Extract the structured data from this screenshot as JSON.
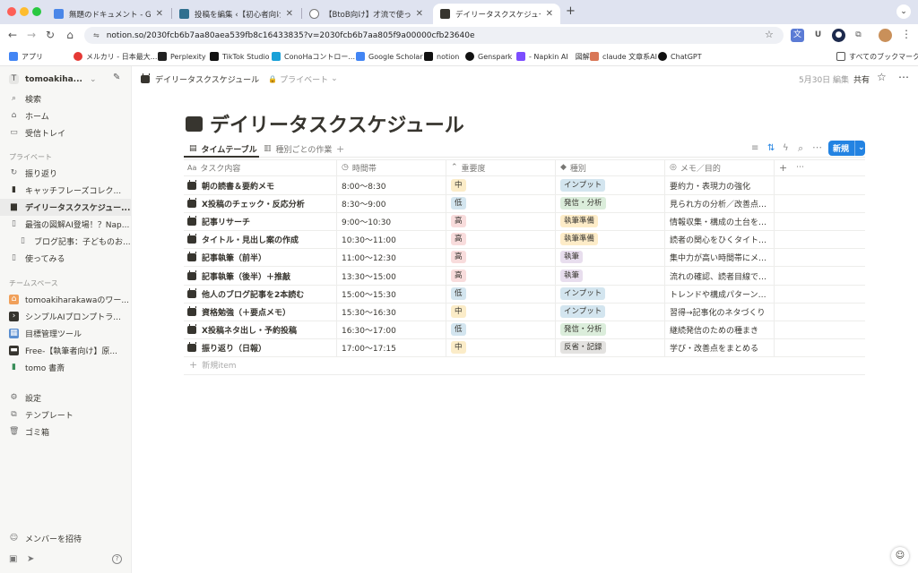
{
  "browser": {
    "tabs": [
      {
        "title": "無題のドキュメント - Google ドキュメント",
        "favicon_color": "#4a86e8"
      },
      {
        "title": "投稿を編集 ‹【初心者向けガイド】",
        "favicon_color": "#2f6f8f"
      },
      {
        "title": "【BtoB向け】才流で使っている",
        "favicon_color": "#777777"
      },
      {
        "title": "デイリータスクスケジュール | ク",
        "favicon_color": "#37352f"
      }
    ],
    "url": "notion.so/2030fcb6b7aa80aea539fb8c16433835?v=2030fcb6b7aa805f9a00000cfb23640e",
    "bookmarks": [
      {
        "label": "アプリ",
        "icon_color": "#4285f4"
      },
      {
        "label": "メルカリ - 日本最大...",
        "icon_color": "#e53935"
      },
      {
        "label": "Perplexity",
        "icon_color": "#222222"
      },
      {
        "label": "TikTok Studio",
        "icon_color": "#111111"
      },
      {
        "label": "ConoHaコントロー...",
        "icon_color": "#19a1d8"
      },
      {
        "label": "Google Scholar",
        "icon_color": "#4285f4"
      },
      {
        "label": "notion",
        "icon_color": "#111111"
      },
      {
        "label": "Genspark",
        "icon_color": "#111111"
      },
      {
        "label": "- Napkin AI　図解",
        "icon_color": "#7c4dff"
      },
      {
        "label": "claude 文章系AI",
        "icon_color": "#d97757"
      },
      {
        "label": "ChatGPT",
        "icon_color": "#111111"
      }
    ],
    "all_bookmarks": "すべてのブックマーク"
  },
  "sidebar": {
    "workspace": "tomoakiha...",
    "workspace_initial": "T",
    "top_items": [
      {
        "label": "検索",
        "icon": "search-icon"
      },
      {
        "label": "ホーム",
        "icon": "home-icon"
      },
      {
        "label": "受信トレイ",
        "icon": "inbox-icon"
      }
    ],
    "private_heading": "プライベート",
    "private_items": [
      {
        "label": "振り返り",
        "icon": "refresh-icon"
      },
      {
        "label": "キャッチフレーズコレク...",
        "icon": "book-icon"
      },
      {
        "label": "デイリータスクスケジュー...",
        "icon": "calendar-icon"
      },
      {
        "label": "最強の図解AI登場！？Nap...",
        "icon": "page-icon"
      },
      {
        "label": "ブログ記事：子どものお...",
        "icon": "page-icon"
      },
      {
        "label": "使ってみる",
        "icon": "page-icon"
      }
    ],
    "team_heading": "チームスペース",
    "team_items": [
      {
        "label": "tomoakiharakawaのワー...",
        "icon": "home-icon"
      },
      {
        "label": "シンプルAIプロンプトラ...",
        "icon": "terminal-icon"
      },
      {
        "label": "目標管理ツール",
        "icon": "grid-icon"
      },
      {
        "label": "Free-【執筆者向け】原...",
        "icon": "clapper-icon"
      },
      {
        "label": "tomo 書斎",
        "icon": "book-icon"
      }
    ],
    "bottom_items": [
      {
        "label": "設定",
        "icon": "gear-icon"
      },
      {
        "label": "テンプレート",
        "icon": "template-icon"
      },
      {
        "label": "ゴミ箱",
        "icon": "trash-icon"
      }
    ],
    "invite": "メンバーを招待"
  },
  "topbar": {
    "breadcrumb": "デイリータスクスケジュール",
    "privacy": "プライベート",
    "edited": "5月30日 編集",
    "share": "共有"
  },
  "page": {
    "title": "デイリータスクスケジュール",
    "views": [
      "タイムテーブル",
      "種別ごとの作業"
    ],
    "new_button": "新規",
    "columns": [
      "タスク内容",
      "時間帯",
      "重要度",
      "種別",
      "メモ／目的"
    ],
    "add_row": "新規item",
    "rows": [
      {
        "task": "朝の読書＆要約メモ",
        "time": "8:00〜8:30",
        "priority": "中",
        "type": "インプット",
        "memo": "要約力・表現力の強化"
      },
      {
        "task": "X投稿のチェック・反応分析",
        "time": "8:30〜9:00",
        "priority": "低",
        "type": "発信・分析",
        "memo": "見られ方の分析／改善点のヒント"
      },
      {
        "task": "記事リサーチ",
        "time": "9:00〜10:30",
        "priority": "高",
        "type": "執筆準備",
        "memo": "情報収集・構成の土台をつくる"
      },
      {
        "task": "タイトル・見出し案の作成",
        "time": "10:30〜11:00",
        "priority": "高",
        "type": "執筆準備",
        "memo": "読者の関心をひくタイトル設計"
      },
      {
        "task": "記事執筆（前半）",
        "time": "11:00〜12:30",
        "priority": "高",
        "type": "執筆",
        "memo": "集中力が高い時間帯にメイン作業"
      },
      {
        "task": "記事執筆（後半）＋推敲",
        "time": "13:30〜15:00",
        "priority": "高",
        "type": "執筆",
        "memo": "流れの確認、読者目線で整える"
      },
      {
        "task": "他人のブログ記事を2本読む",
        "time": "15:00〜15:30",
        "priority": "低",
        "type": "インプット",
        "memo": "トレンドや構成パターンの学び"
      },
      {
        "task": "資格勉強（＋要点メモ）",
        "time": "15:30〜16:30",
        "priority": "中",
        "type": "インプット",
        "memo": "習得→記事化のネタづくり"
      },
      {
        "task": "X投稿ネタ出し・予約投稿",
        "time": "16:30〜17:00",
        "priority": "低",
        "type": "発信・分析",
        "memo": "継続発信のための種まき"
      },
      {
        "task": "振り返り（日報）",
        "time": "17:00〜17:15",
        "priority": "中",
        "type": "反省・記録",
        "memo": "学び・改善点をまとめる"
      }
    ]
  },
  "colors": {
    "priority": {
      "中": "#fbecc8",
      "低": "#d3e5ef",
      "高": "#f8dcdc"
    },
    "type": {
      "インプット": "#d3e5ef",
      "発信・分析": "#dbeddb",
      "執筆準備": "#fdecc8",
      "執筆": "#e8deee",
      "反省・記録": "#e3e2e0"
    },
    "accent": "#2383e2"
  }
}
